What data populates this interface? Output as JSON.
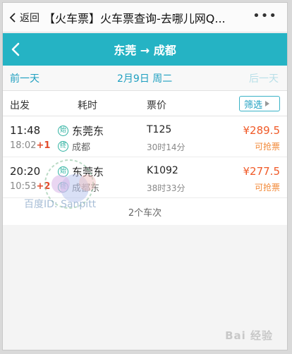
{
  "wechat_bar": {
    "back_label": "返回",
    "title": "【火车票】火车票查询-去哪儿网Q...",
    "more": "•••"
  },
  "nav": {
    "title": "东莞 → 成都"
  },
  "date_bar": {
    "prev": "前一天",
    "current": "2月9日 周二",
    "next": "后一天"
  },
  "columns": {
    "depart": "出发",
    "duration": "耗时",
    "price": "票价",
    "filter": "筛选"
  },
  "badges": {
    "start": "始",
    "end": "终"
  },
  "trains": [
    {
      "dep_time": "11:48",
      "arr_time": "18:02",
      "day_offset": "+1",
      "from": "东莞东",
      "to": "成都",
      "train_no": "T125",
      "duration": "30时14分",
      "price": "¥289.5",
      "status": "可抢票"
    },
    {
      "dep_time": "20:20",
      "arr_time": "10:53",
      "day_offset": "+2",
      "from": "东莞东",
      "to": "成都东",
      "train_no": "K1092",
      "duration": "38时33分",
      "price": "¥277.5",
      "status": "可抢票"
    }
  ],
  "summary": "2个车次",
  "watermark": {
    "id_text": "百度ID: Sanpitt",
    "color": "#8aa7c9"
  },
  "footer_logo": "Bai 经验",
  "colors": {
    "accent": "#25b3c4",
    "price": "#f05a28",
    "link": "#1e9fc0"
  }
}
